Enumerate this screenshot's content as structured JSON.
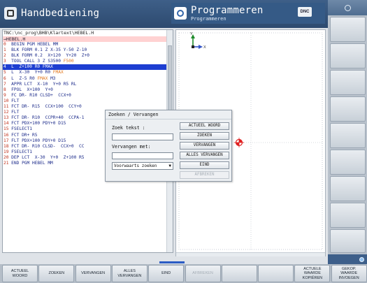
{
  "header": {
    "left_title": "Handbediening",
    "right_title": "Programmeren",
    "right_subtitle": "Programmeren",
    "dnc_label": "DNC"
  },
  "program": {
    "path": "TNC:\\nc_prog\\BHB\\Klartext\\HEBEL.H",
    "file": "→HEBEL.H",
    "lines": [
      {
        "n": "0",
        "text": "  BEGIN PGM HEBEL MM"
      },
      {
        "n": "1",
        "text": "  BLK FORM 0.1 Z X-35 Y-50 Z-10"
      },
      {
        "n": "2",
        "text": "  BLK FORM 0.2  X+120  Y+20  Z+0"
      },
      {
        "n": "3",
        "text": "  TOOL CALL 3 Z S3500 ",
        "hl": "F500"
      },
      {
        "n": "4",
        "text": "  L  Z+100 R0 FMAX",
        "selected": true
      },
      {
        "n": "5",
        "text": "  L  X-30  Y+0 R0 ",
        "hl": "FMAX"
      },
      {
        "n": "6",
        "text": "  L  Z-5 R0 ",
        "hl": "FMAX",
        "tail": " M3"
      },
      {
        "n": "7",
        "text": "  APPR LCT  X-10  Y+0 R5 RL"
      },
      {
        "n": "8",
        "text": "  FPOL  X+100  Y+0"
      },
      {
        "n": "9",
        "text": "  FC DR- R10 CLSD+  CCX+0"
      },
      {
        "n": "10",
        "text": " FLT"
      },
      {
        "n": "11",
        "text": " FCT DR- R15  CCX+100  CCY+0"
      },
      {
        "n": "12",
        "text": " FLT"
      },
      {
        "n": "13",
        "text": " FCT DR- R10  CCPR+40  CCPA-1"
      },
      {
        "n": "14",
        "text": " FCT PDX+100 PDY+0 D15"
      },
      {
        "n": "15",
        "text": " FSELECT1"
      },
      {
        "n": "16",
        "text": " FCT DR+ R5"
      },
      {
        "n": "17",
        "text": " FLT PDX+100 PDY+0 D15"
      },
      {
        "n": "18",
        "text": " FCT DR- R10 CLSD-  CCX+0  CC"
      },
      {
        "n": "19",
        "text": " FSELECT1"
      },
      {
        "n": "20",
        "text": " DEP LCT  X-30  Y+0  Z+100 R5"
      },
      {
        "n": "21",
        "text": " END PGM HEBEL MM"
      }
    ]
  },
  "graphic": {
    "axis_y": "Y",
    "axis_x": "X"
  },
  "dialog": {
    "title": "Zoeken / Vervangen",
    "search_label": "Zoek tekst :",
    "replace_label": "Vervangen met:",
    "search_value": "",
    "replace_value": "",
    "direction": "Voorwaarts zoeken",
    "buttons": {
      "actual_word": "ACTUEEL WOORD",
      "search": "ZOEKEN",
      "replace": "VERVANGEN",
      "replace_all": "ALLES VERVANGEN",
      "end": "EIND",
      "abort": "AFBREKEN"
    }
  },
  "softkeys": [
    {
      "label": "ACTUEEL\nWOORD",
      "disabled": false
    },
    {
      "label": "ZOEKEN",
      "disabled": false
    },
    {
      "label": "VERVANGEN",
      "disabled": false
    },
    {
      "label": "ALLES\nVERVANGEN",
      "disabled": false
    },
    {
      "label": "EIND",
      "disabled": false
    },
    {
      "label": "AFBREKEN",
      "disabled": true
    },
    {
      "label": "",
      "disabled": false
    },
    {
      "label": "",
      "disabled": false
    },
    {
      "label": "ACTUELE\nWAARDE\nKOPIËREN",
      "disabled": false
    },
    {
      "label": "GEKOP.\nWAARDE\nINVOEGEN",
      "disabled": false
    }
  ]
}
